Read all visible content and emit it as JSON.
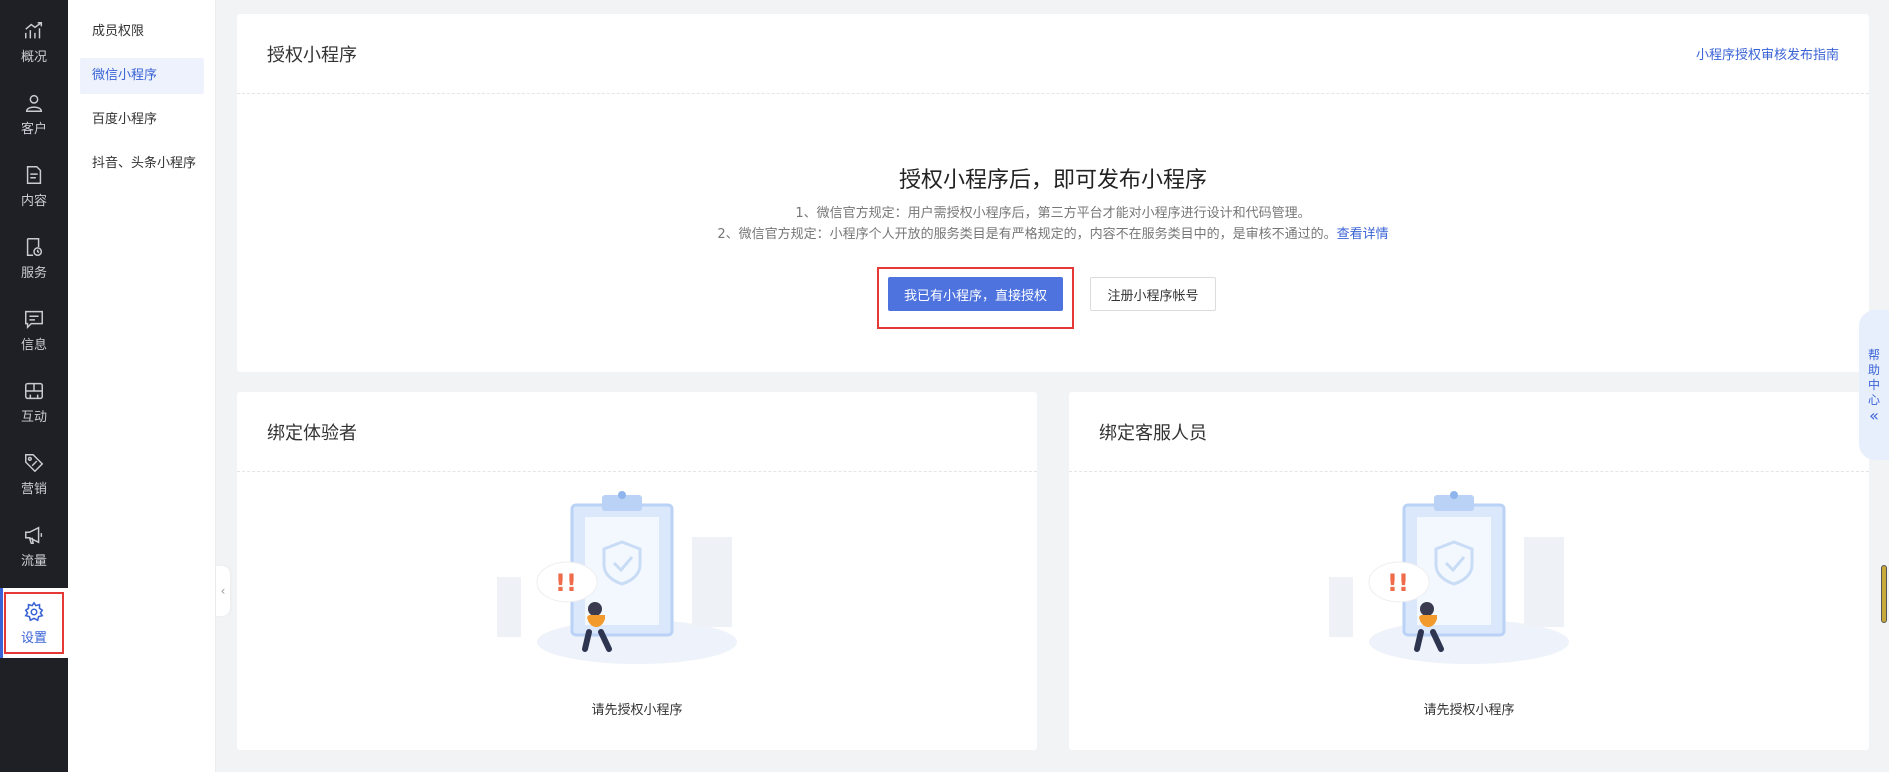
{
  "nav": {
    "items": [
      {
        "label": "概况",
        "icon": "chart-trend-icon"
      },
      {
        "label": "客户",
        "icon": "user-icon"
      },
      {
        "label": "内容",
        "icon": "document-icon"
      },
      {
        "label": "服务",
        "icon": "service-icon"
      },
      {
        "label": "信息",
        "icon": "message-icon"
      },
      {
        "label": "互动",
        "icon": "gamepad-icon"
      },
      {
        "label": "营销",
        "icon": "tag-icon"
      },
      {
        "label": "流量",
        "icon": "megaphone-icon"
      },
      {
        "label": "设置",
        "icon": "settings-icon"
      }
    ],
    "active": "设置"
  },
  "submenu": {
    "items": [
      {
        "label": "成员权限"
      },
      {
        "label": "微信小程序"
      },
      {
        "label": "百度小程序"
      },
      {
        "label": "抖音、头条小程序"
      }
    ],
    "active": "微信小程序"
  },
  "authorize_card": {
    "title": "授权小程序",
    "guide_link": "小程序授权审核发布指南",
    "hero_title": "授权小程序后，即可发布小程序",
    "rule1": "1、微信官方规定：用户需授权小程序后，第三方平台才能对小程序进行设计和代码管理。",
    "rule2": "2、微信官方规定：小程序个人开放的服务类目是有严格规定的，内容不在服务类目中的，是审核不通过的。",
    "rule2_link": "查看详情",
    "primary_button": "我已有小程序，直接授权",
    "secondary_button": "注册小程序帐号"
  },
  "tester_card": {
    "title": "绑定体验者",
    "empty_text": "请先授权小程序"
  },
  "service_card": {
    "title": "绑定客服人员",
    "empty_text": "请先授权小程序"
  },
  "help_tab": {
    "label": "帮助中心",
    "chars": [
      "帮",
      "助",
      "中",
      "心"
    ],
    "arrow": "«"
  },
  "colors": {
    "nav_bg": "#1f2025",
    "accent": "#3a63d6",
    "primary_button": "#4e73df",
    "highlight": "#e53935"
  }
}
